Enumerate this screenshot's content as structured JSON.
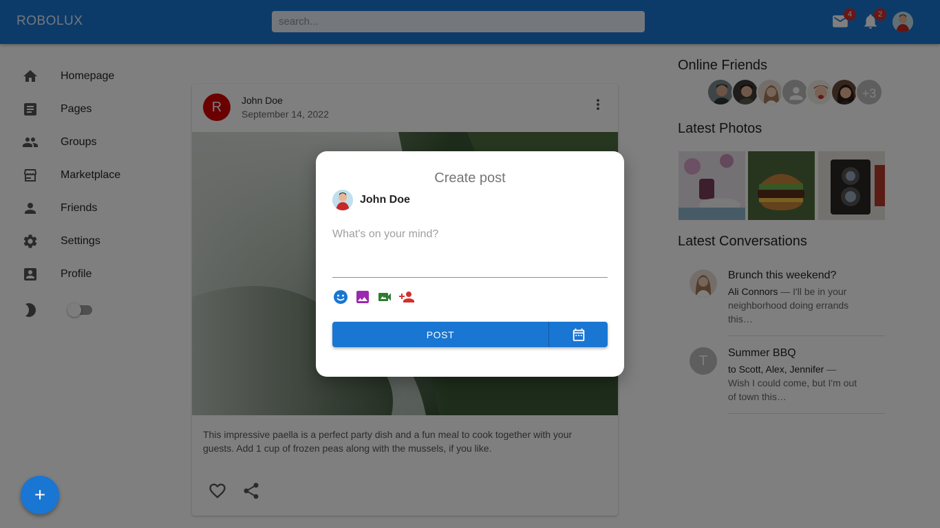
{
  "app": {
    "brand": "ROBOLUX"
  },
  "search": {
    "placeholder": "search..."
  },
  "topbar": {
    "mail_badge": "4",
    "notif_badge": "2"
  },
  "sidebar": {
    "items": [
      {
        "label": "Homepage",
        "icon": "home-icon"
      },
      {
        "label": "Pages",
        "icon": "article-icon"
      },
      {
        "label": "Groups",
        "icon": "group-icon"
      },
      {
        "label": "Marketplace",
        "icon": "storefront-icon"
      },
      {
        "label": "Friends",
        "icon": "person-icon"
      },
      {
        "label": "Settings",
        "icon": "gear-icon"
      },
      {
        "label": "Profile",
        "icon": "account-box-icon"
      }
    ],
    "dark_mode": false
  },
  "post": {
    "avatar_letter": "R",
    "author": "John Doe",
    "date": "September 14, 2022",
    "text": "This impressive paella is a perfect party dish and a fun meal to cook together with your guests. Add 1 cup of frozen peas along with the mussels, if you like."
  },
  "right": {
    "online_title": "Online Friends",
    "more_friends": "+3",
    "photos_title": "Latest Photos",
    "conversations_title": "Latest Conversations",
    "conversations": [
      {
        "title": "Brunch this weekend?",
        "who": "Ali Connors",
        "text": " — I'll be in your neighborhood doing errands this…"
      },
      {
        "title": "Summer BBQ",
        "avatar_letter": "T",
        "who": "to Scott, Alex, Jennifer",
        "text": " — Wish I could come, but I'm out of town this…"
      }
    ]
  },
  "modal": {
    "title": "Create post",
    "user": "John Doe",
    "placeholder": "What's on your mind?",
    "post_label": "POST"
  },
  "fab": {
    "label": "+"
  },
  "colors": {
    "primary": "#1976d2",
    "badge": "#d32f2f",
    "avatar_red": "#d50000"
  }
}
